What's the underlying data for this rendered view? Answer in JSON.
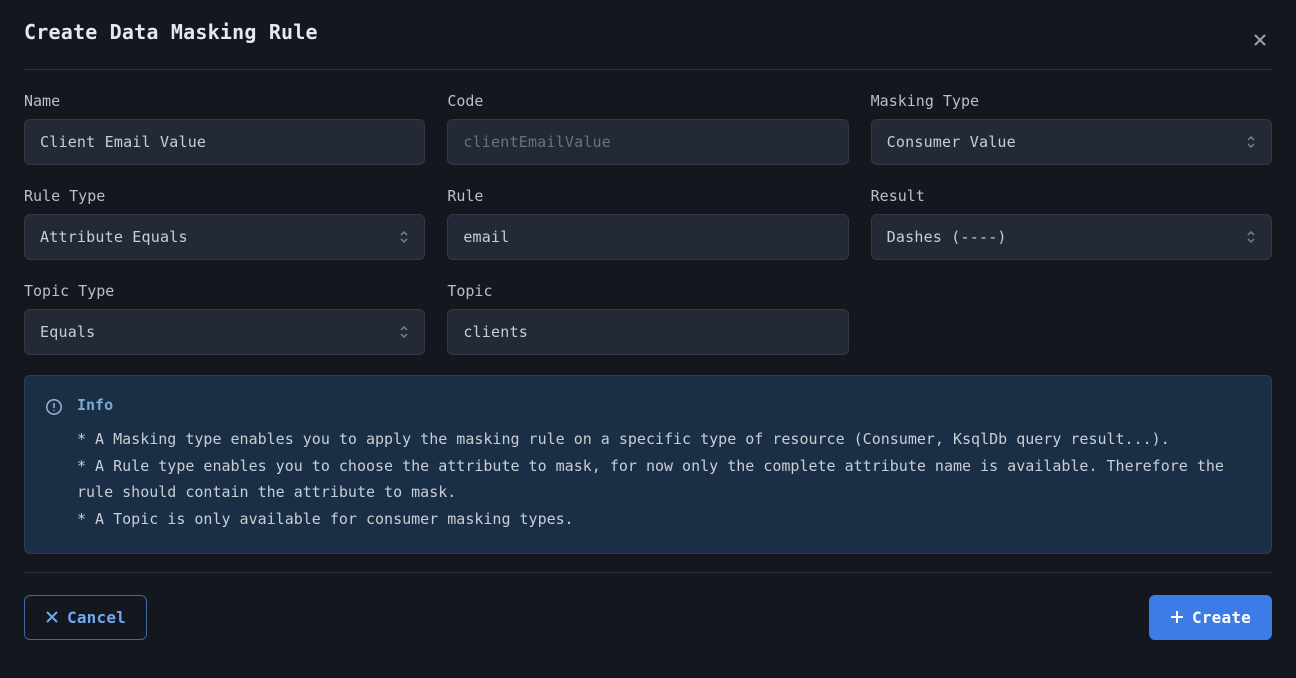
{
  "dialog": {
    "title": "Create Data Masking Rule"
  },
  "fields": {
    "name": {
      "label": "Name",
      "value": "Client Email Value"
    },
    "code": {
      "label": "Code",
      "placeholder": "clientEmailValue",
      "value": ""
    },
    "maskingType": {
      "label": "Masking Type",
      "value": "Consumer Value"
    },
    "ruleType": {
      "label": "Rule Type",
      "value": "Attribute Equals"
    },
    "rule": {
      "label": "Rule",
      "value": "email"
    },
    "result": {
      "label": "Result",
      "value": "Dashes (----)"
    },
    "topicType": {
      "label": "Topic Type",
      "value": "Equals"
    },
    "topic": {
      "label": "Topic",
      "value": "clients"
    }
  },
  "info": {
    "title": "Info",
    "text": "* A Masking type enables you to apply the masking rule on a specific type of resource (Consumer, KsqlDb query result...).\n* A Rule type enables you to choose the attribute to mask, for now only the complete attribute name is available. Therefore the rule should contain the attribute to mask.\n* A Topic is only available for consumer masking types."
  },
  "buttons": {
    "cancel": "Cancel",
    "create": "Create"
  }
}
